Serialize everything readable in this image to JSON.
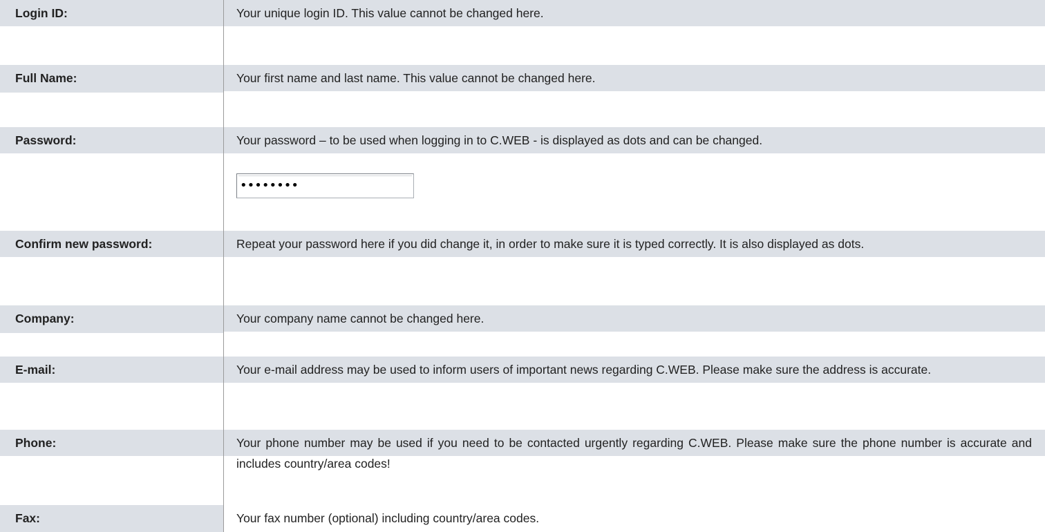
{
  "rows": [
    {
      "label": "Login ID:",
      "text": "Your unique login ID. This value cannot be changed here."
    },
    {
      "label": "Full Name:",
      "text": "Your first name and last name. This value cannot be changed here."
    },
    {
      "label": "Password:",
      "text": "Your password – to be used when logging in to C.WEB - is displayed as dots and can be changed."
    },
    {
      "label": "Confirm new password:",
      "text": "Repeat your password here if you did change it, in order to make sure it is typed correctly.  It is also displayed as dots."
    },
    {
      "label": "Company:",
      "text": "Your company name cannot be changed here."
    },
    {
      "label": "E-mail:",
      "text": "Your e-mail address may be used to inform users of important news regarding C.WEB. Please make sure the address is accurate."
    },
    {
      "label": "Phone:",
      "text": "Your phone number may be used if you need to be contacted urgently regarding C.WEB. Please make sure the phone number is accurate and includes country/area codes!"
    },
    {
      "label": "Fax:",
      "text": "Your fax number (optional) including country/area codes."
    }
  ],
  "password_field": {
    "value": "••••••••"
  },
  "colors": {
    "header_band": "#dce0e6",
    "divider": "#9a9a9a"
  }
}
